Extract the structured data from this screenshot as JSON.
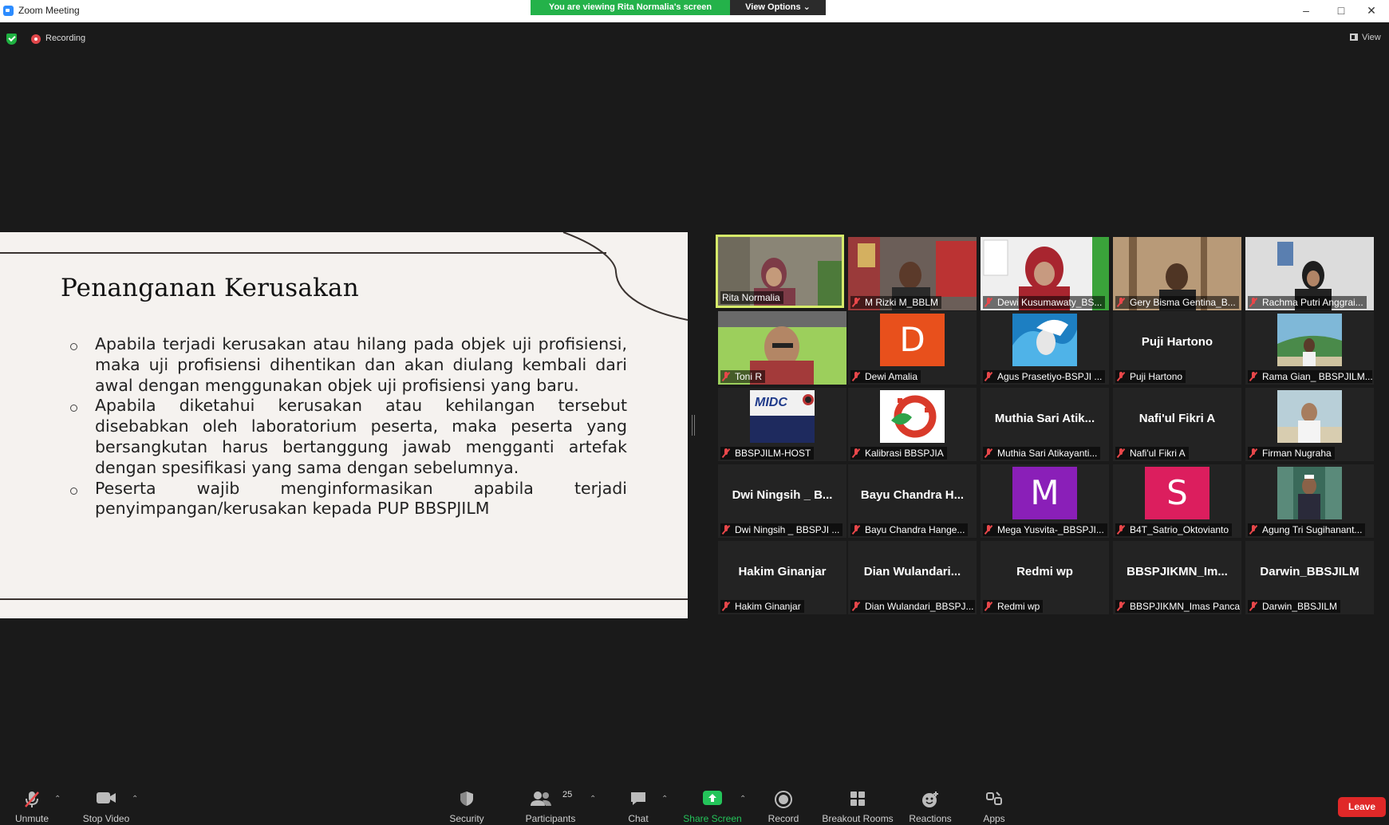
{
  "window": {
    "title": "Zoom Meeting",
    "viewing_banner": "You are viewing Rita Normalia's screen",
    "view_options": "View Options ⌄"
  },
  "topbar": {
    "recording_label": "Recording",
    "view_label": "View"
  },
  "slide": {
    "title": "Penanganan Kerusakan",
    "bullets": [
      "Apabila terjadi kerusakan atau hilang pada objek uji profisiensi, maka uji profisiensi dihentikan dan akan diulang kembali dari awal dengan menggunakan objek uji profisiensi yang baru.",
      "Apabila diketahui kerusakan atau kehilangan tersebut disebabkan oleh laboratorium peserta, maka peserta yang bersangkutan harus bertanggung jawab mengganti artefak dengan spesifikasi yang sama dengan sebelumnya.",
      "Peserta wajib menginformasikan apabila terjadi penyimpangan/kerusakan kepada PUP BBSPJILM"
    ]
  },
  "participants": [
    {
      "name": "Rita Normalia"
    },
    {
      "name": "M Rizki M_BBLM"
    },
    {
      "name": "Dewi Kusumawaty_BS..."
    },
    {
      "name": "Gery Bisma Gentina_B..."
    },
    {
      "name": "Rachma Putri Anggrai..."
    },
    {
      "name": "Toni R"
    },
    {
      "name": "Dewi Amalia",
      "avatar_letter": "D"
    },
    {
      "name": "Agus Prasetiyo-BSPJI ..."
    },
    {
      "name": "Puji Hartono",
      "display": "Puji Hartono"
    },
    {
      "name": "Rama Gian_ BBSPJILM..."
    },
    {
      "name": "BBSPJILM-HOST",
      "logo_text": "MIDC"
    },
    {
      "name": "Kalibrasi BBSPJIA"
    },
    {
      "name": "Muthia Sari Atikayanti...",
      "display": "Muthia Sari Atik..."
    },
    {
      "name": "Nafi'ul Fikri A",
      "display": "Nafi'ul Fikri A"
    },
    {
      "name": "Firman Nugraha"
    },
    {
      "name": "Dwi Ningsih _ BBSPJI ...",
      "display": "Dwi Ningsih _ B..."
    },
    {
      "name": "Bayu Chandra Hange...",
      "display": "Bayu Chandra H..."
    },
    {
      "name": "Mega Yusvita-_BBSPJI...",
      "avatar_letter": "M"
    },
    {
      "name": "B4T_Satrio_Oktovianto",
      "avatar_letter": "S"
    },
    {
      "name": "Agung Tri Sugihanant..."
    },
    {
      "name": "Hakim Ginanjar",
      "display": "Hakim Ginanjar"
    },
    {
      "name": "Dian Wulandari_BBSPJ...",
      "display": "Dian Wulandari..."
    },
    {
      "name": "Redmi wp",
      "display": "Redmi wp"
    },
    {
      "name": "BBSPJIKMN_Imas Panca",
      "display": "BBSPJIKMN_Im..."
    },
    {
      "name": "Darwin_BBSJILM",
      "display": "Darwin_BBSJILM"
    }
  ],
  "toolbar": {
    "unmute": "Unmute",
    "stop_video": "Stop Video",
    "security": "Security",
    "participants": "Participants",
    "participants_count": "25",
    "chat": "Chat",
    "share_screen": "Share Screen",
    "record": "Record",
    "breakout_rooms": "Breakout Rooms",
    "reactions": "Reactions",
    "apps": "Apps",
    "leave": "Leave"
  },
  "colors": {
    "active_speaker_border": "#d6eb6a",
    "banner_green": "#24b24a",
    "leave_red": "#e02828",
    "avatar_orange": "#e8501c",
    "avatar_purple": "#8a1fb8",
    "avatar_pink": "#dc1e5e"
  }
}
